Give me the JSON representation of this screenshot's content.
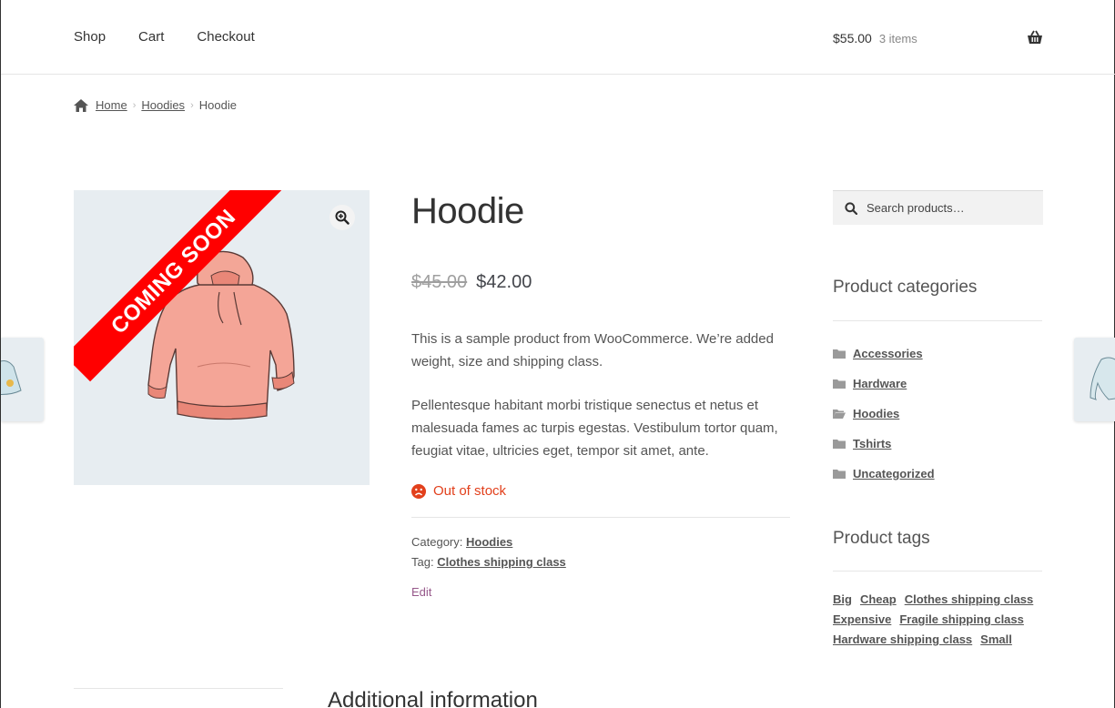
{
  "nav": {
    "items": [
      {
        "label": "Shop"
      },
      {
        "label": "Cart"
      },
      {
        "label": "Checkout"
      }
    ]
  },
  "cart": {
    "amount": "$55.00",
    "count": "3 items",
    "icon": "basket-icon"
  },
  "breadcrumb": {
    "home": "Home",
    "category": "Hoodies",
    "current": "Hoodie"
  },
  "product": {
    "badge": "COMING SOON",
    "title": "Hoodie",
    "old_price": "$45.00",
    "price": "$42.00",
    "description": [
      "This is a sample product from WooCommerce. We’re added weight, size and shipping class.",
      "Pellentesque habitant morbi tristique senectus et netus et malesuada fames ac turpis egestas. Vestibulum tortor quam, feugiat vitae, ultricies eget, tempor sit amet, ante."
    ],
    "stock": "Out of stock",
    "category_label": "Category:",
    "category": "Hoodies",
    "tag_label": "Tag:",
    "tag": "Clothes shipping class",
    "edit": "Edit"
  },
  "sidebar": {
    "search_placeholder": "Search products…",
    "categories_title": "Product categories",
    "categories": [
      "Accessories",
      "Hardware",
      "Hoodies",
      "Tshirts",
      "Uncategorized"
    ],
    "tags_title": "Product tags",
    "tags": [
      "Big",
      "Cheap",
      "Clothes shipping class",
      "Expensive",
      "Fragile shipping class",
      "Hardware shipping class",
      "Small"
    ]
  },
  "bottom": {
    "heading": "Additional information"
  },
  "colors": {
    "accent": "#96588a",
    "sale_badge": "#ff0000",
    "out_of_stock": "#e2401c"
  }
}
